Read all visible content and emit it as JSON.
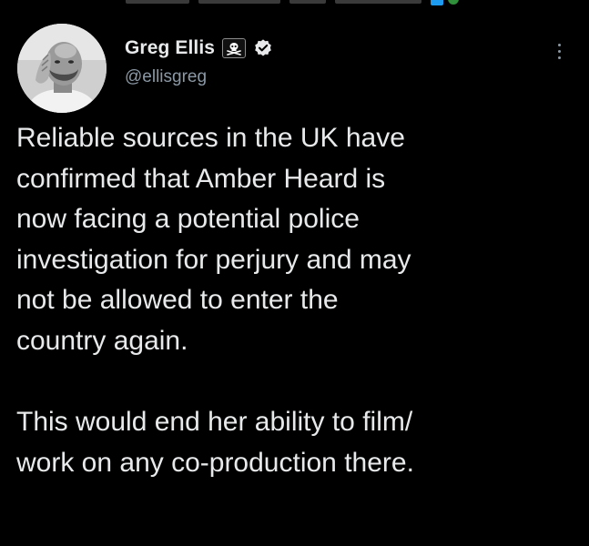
{
  "tweet": {
    "author": {
      "display_name": "Greg Ellis",
      "handle": "@ellisgreg",
      "name_emoji": "skull-and-crossbones-icon",
      "verified_icon": "verified-badge-icon"
    },
    "menu_icon": "more-options-icon",
    "paragraphs": [
      {
        "lines": [
          "Reliable sources in the UK have",
          "confirmed that Amber Heard is",
          "now facing a potential police",
          "investigation for perjury and may",
          "not be allowed to enter the",
          "country again."
        ]
      },
      {
        "lines": [
          "This would end her ability to film/",
          "work on any co-production there."
        ]
      }
    ]
  },
  "colors": {
    "background": "#000000",
    "primary_text": "#e7e9ea",
    "secondary_text": "#8b98a5",
    "verified": "#e7e9ea"
  }
}
